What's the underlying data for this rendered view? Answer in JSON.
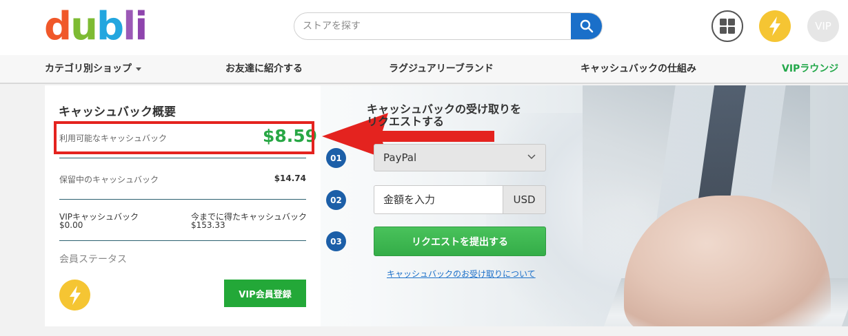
{
  "logo": {
    "letters": [
      "d",
      "u",
      "b",
      "l",
      "i"
    ],
    "colors": [
      "#f0582a",
      "#7dbb33",
      "#23a6df",
      "#9b59b6",
      "#8e44ad"
    ]
  },
  "search": {
    "placeholder": "ストアを探す",
    "icon": "search-icon"
  },
  "header_icons": {
    "apps": "grid-icon",
    "boost": "lightning-icon",
    "vip": "VIP"
  },
  "nav": {
    "categories": "カテゴリ別ショップ",
    "refer": "お友達に紹介する",
    "luxury": "ラグジュアリーブランド",
    "how_it_works": "キャッシュバックの仕組み",
    "vip_lounge": "VIPラウンジ"
  },
  "overview": {
    "title": "キャッシュバック概要",
    "available_label": "利用可能なキャッシュバック",
    "available_value": "$8.59",
    "pending_label": "保留中のキャッシュバック",
    "pending_value": "$14.74",
    "vip_label": "VIPキャッシュバック",
    "vip_value": "$0.00",
    "earned_label": "今までに得たキャッシュバック",
    "earned_value": "$153.33",
    "status_label": "会員ステータス",
    "vip_button": "VIP会員登録"
  },
  "request": {
    "title_line1": "キャッシュバックの受け取りを",
    "title_line2": "リクエストする",
    "step1": "01",
    "step2": "02",
    "step3": "03",
    "method": "PayPal",
    "amount_placeholder": "金額を入力",
    "currency": "USD",
    "submit": "リクエストを提出する",
    "help": "キャッシュバックのお受け取りについて"
  },
  "colors": {
    "accent_green": "#28a745",
    "highlight_red": "#e4231f",
    "step_blue": "#1c5fa8",
    "search_blue": "#1a6fc9"
  }
}
